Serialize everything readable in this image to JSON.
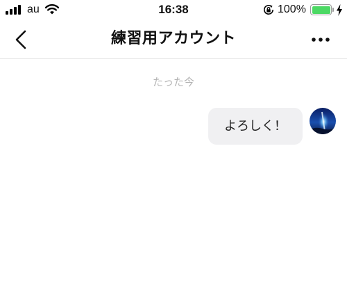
{
  "status_bar": {
    "carrier": "au",
    "time": "16:38",
    "battery_percent": "100%",
    "battery_level": 1.0,
    "battery_color": "#4cd964",
    "icons": [
      "signal-icon",
      "wifi-icon",
      "orientation-lock-icon",
      "battery-icon",
      "charging-icon"
    ]
  },
  "nav": {
    "title": "練習用アカウント",
    "back_icon": "chevron-left-icon",
    "more_icon": "more-horizontal-icon"
  },
  "chat": {
    "timestamp": "たった今",
    "messages": [
      {
        "text": "よろしく！",
        "sender": "self"
      }
    ],
    "bubble_color": "#f0f0f2"
  }
}
